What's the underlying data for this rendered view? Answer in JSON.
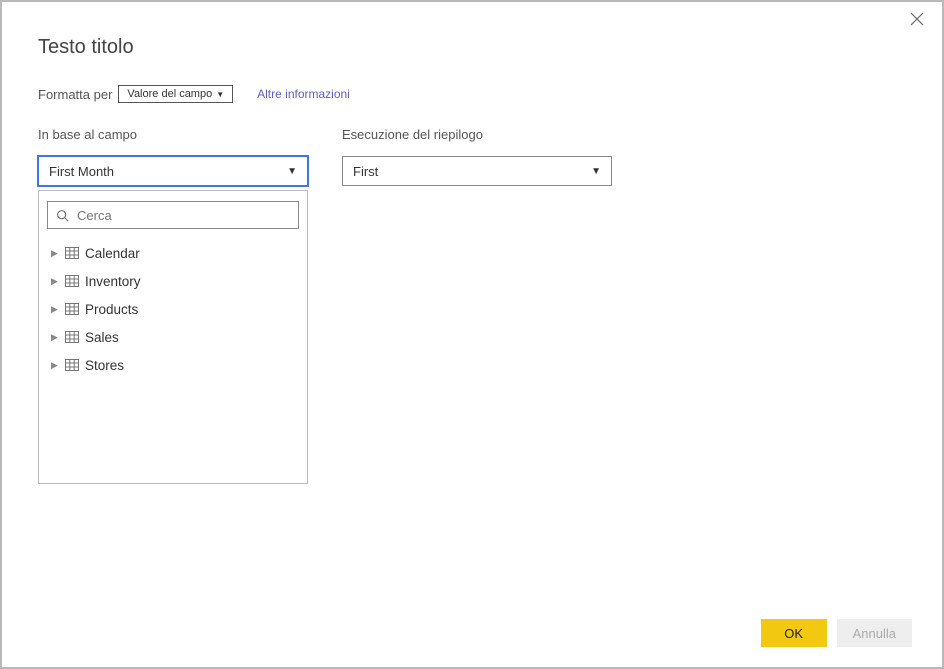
{
  "dialog": {
    "title": "Testo titolo",
    "format_label": "Formatta per",
    "format_value": "Valore del campo",
    "more_info": "Altre informazioni"
  },
  "field_col": {
    "label": "In base al campo",
    "selected": "First Month",
    "search_placeholder": "Cerca",
    "items": [
      {
        "label": "Calendar"
      },
      {
        "label": "Inventory"
      },
      {
        "label": "Products"
      },
      {
        "label": "Sales"
      },
      {
        "label": "Stores"
      }
    ]
  },
  "summary_col": {
    "label": "Esecuzione del riepilogo",
    "selected": "First"
  },
  "footer": {
    "ok": "OK",
    "cancel": "Annulla"
  }
}
